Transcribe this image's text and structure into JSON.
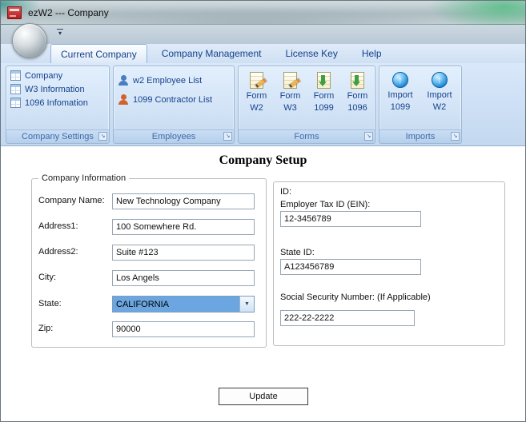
{
  "window": {
    "title": "ezW2 --- Company"
  },
  "icons": {
    "qat_arrow": "▾",
    "combo_arrow": "▼",
    "import_arrow": "↑",
    "launcher_arrow": "↘"
  },
  "colors": {
    "ribbon_text": "#15428b",
    "group_caption_text": "#3e6aaa",
    "combo_selection": "#6ba6e0",
    "app_icon_red": "#c62828"
  },
  "ribbon": {
    "tabs": [
      {
        "label": "Current Company"
      },
      {
        "label": "Company Management"
      },
      {
        "label": "License Key"
      },
      {
        "label": "Help"
      }
    ],
    "groups": {
      "company_settings": {
        "title": "Company Settings",
        "items": [
          {
            "label": "Company"
          },
          {
            "label": "W3 Information"
          },
          {
            "label": "1096 Infomation"
          }
        ]
      },
      "employees": {
        "title": "Employees",
        "items": [
          {
            "label": "w2 Employee List"
          },
          {
            "label": "1099 Contractor List"
          }
        ]
      },
      "forms": {
        "title": "Forms",
        "items": [
          {
            "line1": "Form",
            "line2": "W2"
          },
          {
            "line1": "Form",
            "line2": "W3"
          },
          {
            "line1": "Form",
            "line2": "1099"
          },
          {
            "line1": "Form",
            "line2": "1096"
          }
        ]
      },
      "imports": {
        "title": "Imports",
        "items": [
          {
            "line1": "Import",
            "line2": "1099"
          },
          {
            "line1": "Import",
            "line2": "W2"
          }
        ]
      }
    }
  },
  "main": {
    "heading": "Company Setup",
    "company_info": {
      "legend": "Company Information",
      "fields": [
        {
          "label": "Company Name:",
          "value": "New Technology Company"
        },
        {
          "label": "Address1:",
          "value": "100 Somewhere Rd."
        },
        {
          "label": "Address2:",
          "value": "Suite #123"
        },
        {
          "label": "City:",
          "value": "Los Angels"
        },
        {
          "label": "State:",
          "value": "CALIFORNIA"
        },
        {
          "label": "Zip:",
          "value": "90000"
        }
      ]
    },
    "ids": {
      "label": "ID:",
      "ein_label": "Employer Tax ID (EIN):",
      "ein_value": "12-3456789",
      "state_id_label": "State ID:",
      "state_id_value": "A123456789",
      "ssn_label": "Social Security Number: (If Applicable)",
      "ssn_value": "222-22-2222"
    },
    "update_label": "Update"
  }
}
